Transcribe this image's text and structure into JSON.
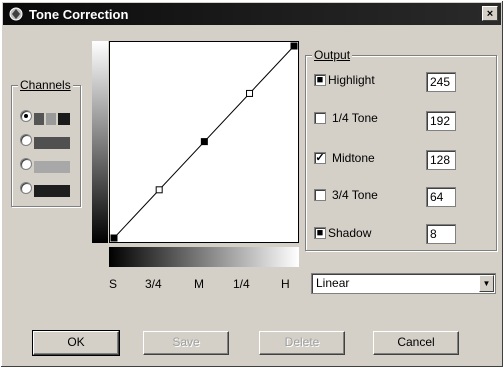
{
  "window": {
    "title": "Tone Correction",
    "close": "×"
  },
  "channels": {
    "label": "Channels",
    "items": [
      {
        "selected": true,
        "colors": [
          "#555555",
          "#9a9a9a",
          "#1a1a1a"
        ]
      },
      {
        "selected": false,
        "colors": [
          "#505050"
        ]
      },
      {
        "selected": false,
        "colors": [
          "#a8a8a8"
        ]
      },
      {
        "selected": false,
        "colors": [
          "#1e1e1e"
        ]
      }
    ]
  },
  "curve": {
    "points": [
      {
        "name": "shadow",
        "input": 0,
        "output": 0,
        "style": "filled"
      },
      {
        "name": "3/4 tone",
        "input": 64,
        "output": 64,
        "style": "hollow"
      },
      {
        "name": "midtone",
        "input": 128,
        "output": 128,
        "style": "filled"
      },
      {
        "name": "1/4 tone",
        "input": 192,
        "output": 192,
        "style": "hollow"
      },
      {
        "name": "highlight",
        "input": 255,
        "output": 255,
        "style": "filled"
      }
    ],
    "axis_labels": [
      "S",
      "3/4",
      "M",
      "1/4",
      "H"
    ]
  },
  "output": {
    "label": "Output",
    "rows": [
      {
        "label": "Highlight",
        "control": "radio-on",
        "value": "245"
      },
      {
        "label": "1/4 Tone",
        "control": "checkbox",
        "checked": false,
        "value": "192"
      },
      {
        "label": "Midtone",
        "control": "checkbox",
        "checked": true,
        "value": "128"
      },
      {
        "label": "3/4 Tone",
        "control": "checkbox",
        "checked": false,
        "value": "64"
      },
      {
        "label": "Shadow",
        "control": "radio-on",
        "value": "8"
      }
    ]
  },
  "curve_type": {
    "selected": "Linear"
  },
  "buttons": {
    "ok": "OK",
    "save": "Save",
    "delete": "Delete",
    "cancel": "Cancel"
  }
}
